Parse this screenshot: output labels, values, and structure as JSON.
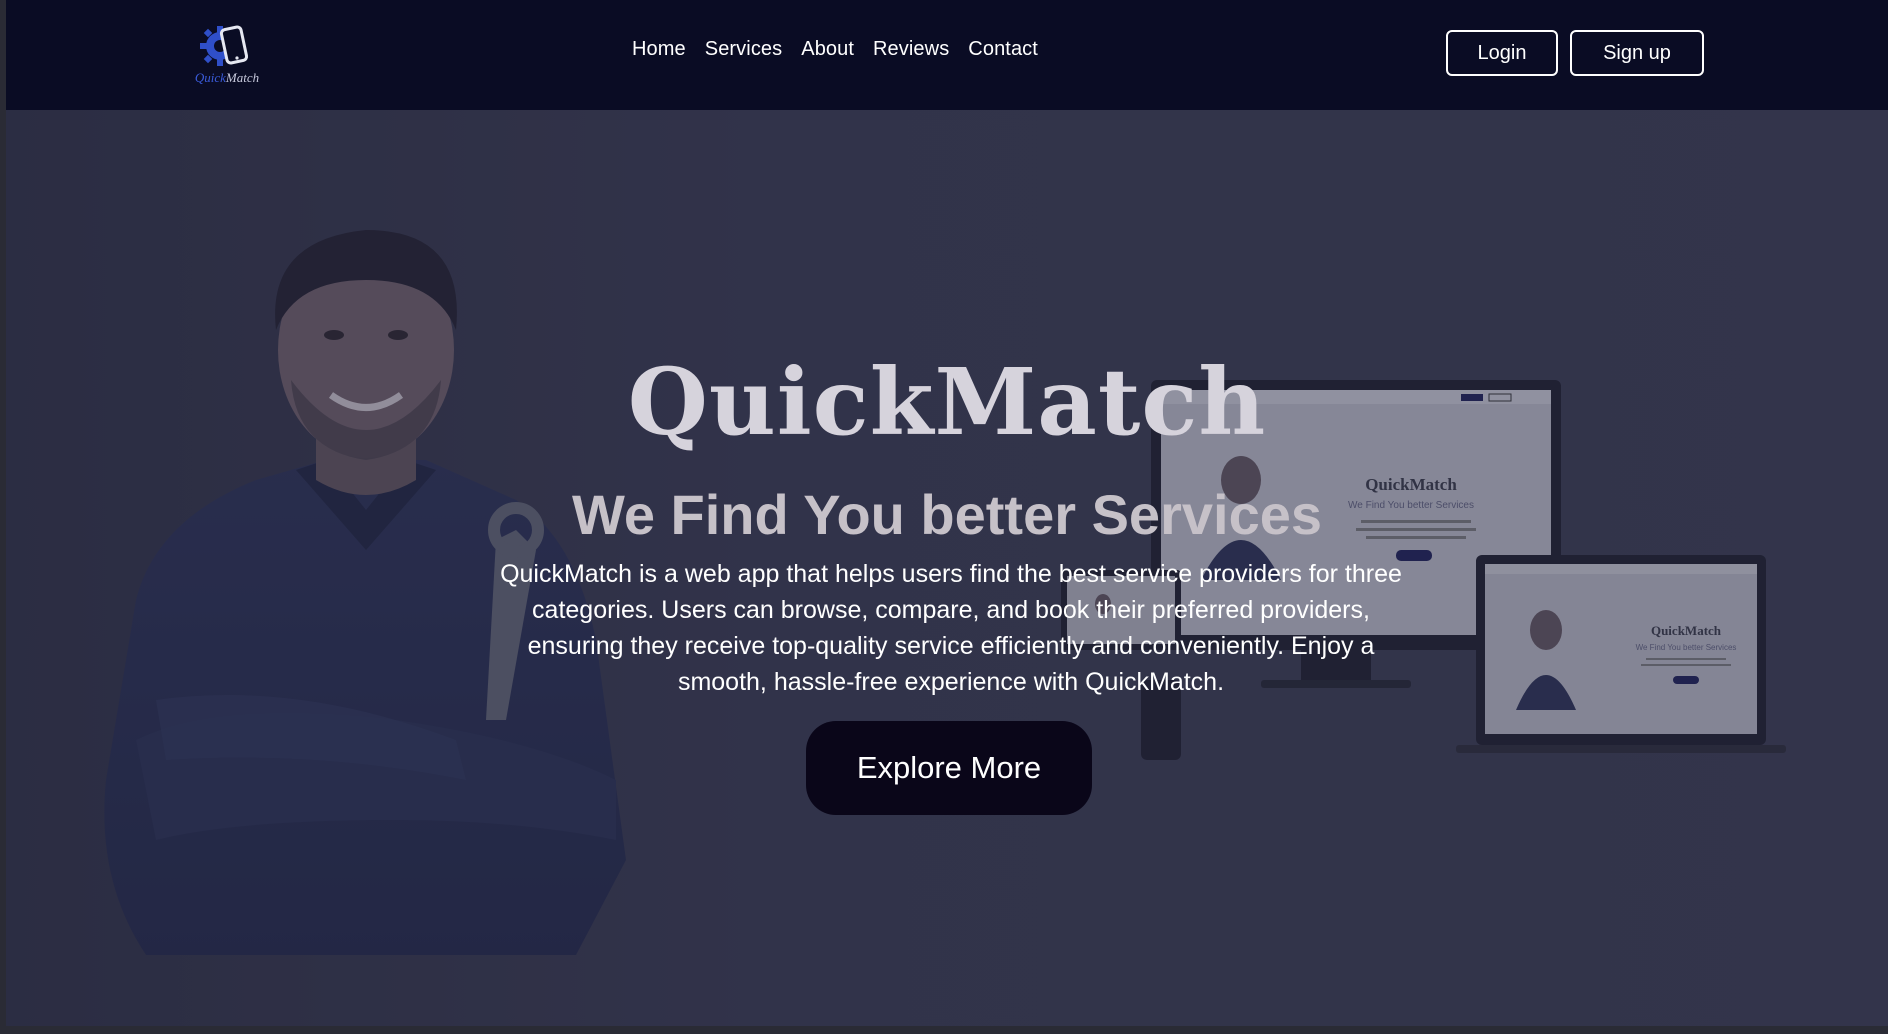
{
  "brand": {
    "name_part1": "Quick",
    "name_part2": "Match",
    "colors": {
      "navbar_bg": "#0a0c24",
      "hero_bg": "#3a3b50",
      "button_dark": "#0a0619",
      "logo_blue": "#3a5bd9"
    }
  },
  "nav": {
    "links": [
      "Home",
      "Services",
      "About",
      "Reviews",
      "Contact"
    ],
    "login_label": "Login",
    "signup_label": "Sign up"
  },
  "hero": {
    "title": "QuickMatch",
    "subtitle": "We Find You better Services",
    "description": "QuickMatch is a web app that helps users find the best service providers for three categories. Users can browse, compare, and book their preferred providers, ensuring they receive top-quality service efficiently and conveniently. Enjoy a smooth, hassle-free experience with QuickMatch.",
    "cta_label": "Explore More"
  },
  "mockup": {
    "title": "QuickMatch",
    "subtitle": "We Find You better Services"
  },
  "icons": {
    "logo": "gear-phone-logo-icon",
    "person": "mechanic-person-image",
    "devices": "devices-mockup-image"
  }
}
